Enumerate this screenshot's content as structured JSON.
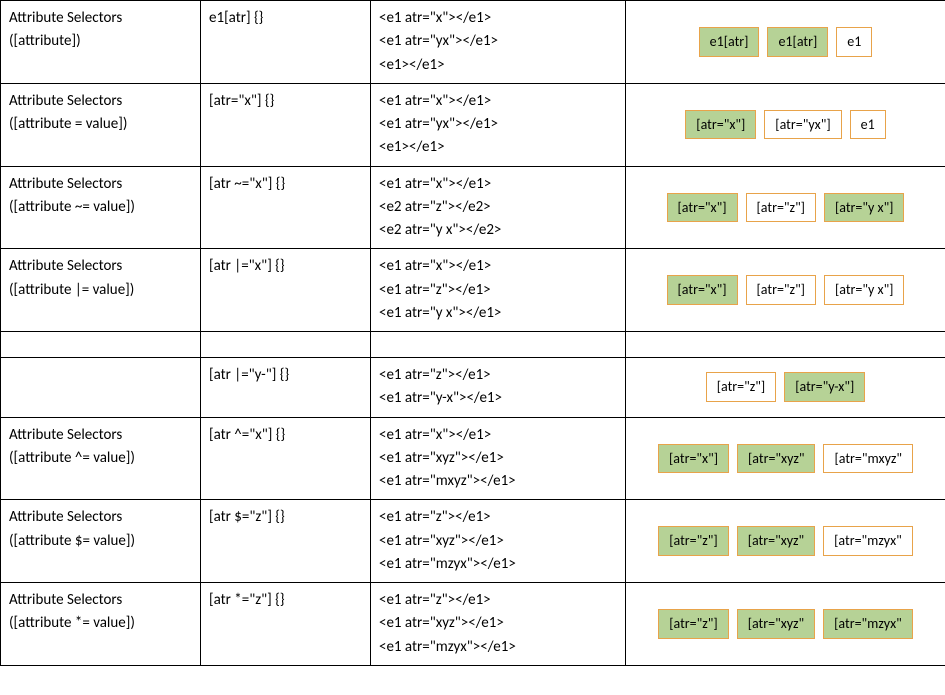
{
  "rows": [
    {
      "name_line1": "Attribute Selectors",
      "name_line2": "([attribute])",
      "selector": "e1[atr] {}",
      "html_lines": [
        "<e1 atr=\"x\"></e1>",
        "<e1 atr=\"yx\"></e1>",
        "<e1></e1>"
      ],
      "boxes": [
        {
          "label": "e1[atr]",
          "match": true
        },
        {
          "label": "e1[atr]",
          "match": true
        },
        {
          "label": "e1",
          "match": false
        }
      ]
    },
    {
      "name_line1": "Attribute Selectors",
      "name_line2": "([attribute = value])",
      "selector": "[atr=\"x\"] {}",
      "html_lines": [
        "<e1 atr=\"x\"></e1>",
        "<e1 atr=\"yx\"></e1>",
        "<e1></e1>"
      ],
      "boxes": [
        {
          "label": "[atr=\"x\"]",
          "match": true
        },
        {
          "label": "[atr=\"yx\"]",
          "match": false
        },
        {
          "label": "e1",
          "match": false
        }
      ]
    },
    {
      "name_line1": "Attribute Selectors",
      "name_line2": "([attribute ~= value])",
      "selector": "[atr ~=\"x\"] {}",
      "html_lines": [
        "<e1 atr=\"x\"></e1>",
        "<e2 atr=\"z\"></e2>",
        "<e2 atr=\"y x\"></e2>"
      ],
      "boxes": [
        {
          "label": "[atr=\"x\"]",
          "match": true
        },
        {
          "label": "[atr=\"z\"]",
          "match": false
        },
        {
          "label": "[atr=\"y x\"]",
          "match": true
        }
      ]
    },
    {
      "name_line1": "Attribute Selectors",
      "name_line2": "([attribute |= value])",
      "selector": "[atr |=\"x\"] {}",
      "html_lines": [
        "<e1 atr=\"x\"></e1>",
        "<e1 atr=\"z\"></e1>",
        "<e1 atr=\"y x\"></e1>"
      ],
      "boxes": [
        {
          "label": "[atr=\"x\"]",
          "match": true
        },
        {
          "label": "[atr=\"z\"]",
          "match": false
        },
        {
          "label": "[atr=\"y x\"]",
          "match": false
        }
      ]
    },
    {
      "empty": true
    },
    {
      "name_line1": "",
      "name_line2": "",
      "selector": "[atr |=\"y-\"] {}",
      "html_lines": [
        "<e1 atr=\"z\"></e1>",
        "<e1 atr=\"y-x\"></e1>"
      ],
      "boxes": [
        {
          "label": "[atr=\"z\"]",
          "match": false
        },
        {
          "label": "[atr=\"y-x\"]",
          "match": true
        }
      ]
    },
    {
      "name_line1": "Attribute Selectors",
      "name_line2": "([attribute ^= value])",
      "selector": "[atr ^=\"x\"] {}",
      "html_lines": [
        "<e1 atr=\"x\"></e1>",
        "<e1 atr=\"xyz\"></e1>",
        "<e1 atr=\"mxyz\"></e1>"
      ],
      "boxes": [
        {
          "label": "[atr=\"x\"]",
          "match": true
        },
        {
          "label": "[atr=\"xyz\"",
          "match": true
        },
        {
          "label": "[atr=\"mxyz\"",
          "match": false
        }
      ]
    },
    {
      "name_line1": "Attribute Selectors",
      "name_line2": "([attribute $= value])",
      "selector": "[atr $=\"z\"] {}",
      "html_lines": [
        "<e1 atr=\"z\"></e1>",
        "<e1 atr=\"xyz\"></e1>",
        "<e1 atr=\"mzyx\"></e1>"
      ],
      "boxes": [
        {
          "label": "[atr=\"z\"]",
          "match": true
        },
        {
          "label": "[atr=\"xyz\"",
          "match": true
        },
        {
          "label": "[atr=\"mzyx\"",
          "match": false
        }
      ]
    },
    {
      "name_line1": "Attribute Selectors",
      "name_line2": "([attribute *= value])",
      "selector": "[atr *=\"z\"] {}",
      "html_lines": [
        "<e1 atr=\"z\"></e1>",
        "<e1 atr=\"xyz\"></e1>",
        "<e1 atr=\"mzyx\"></e1>"
      ],
      "boxes": [
        {
          "label": "[atr=\"z\"]",
          "match": true
        },
        {
          "label": "[atr=\"xyz\"",
          "match": true
        },
        {
          "label": "[atr=\"mzyx\"",
          "match": true
        }
      ]
    }
  ]
}
